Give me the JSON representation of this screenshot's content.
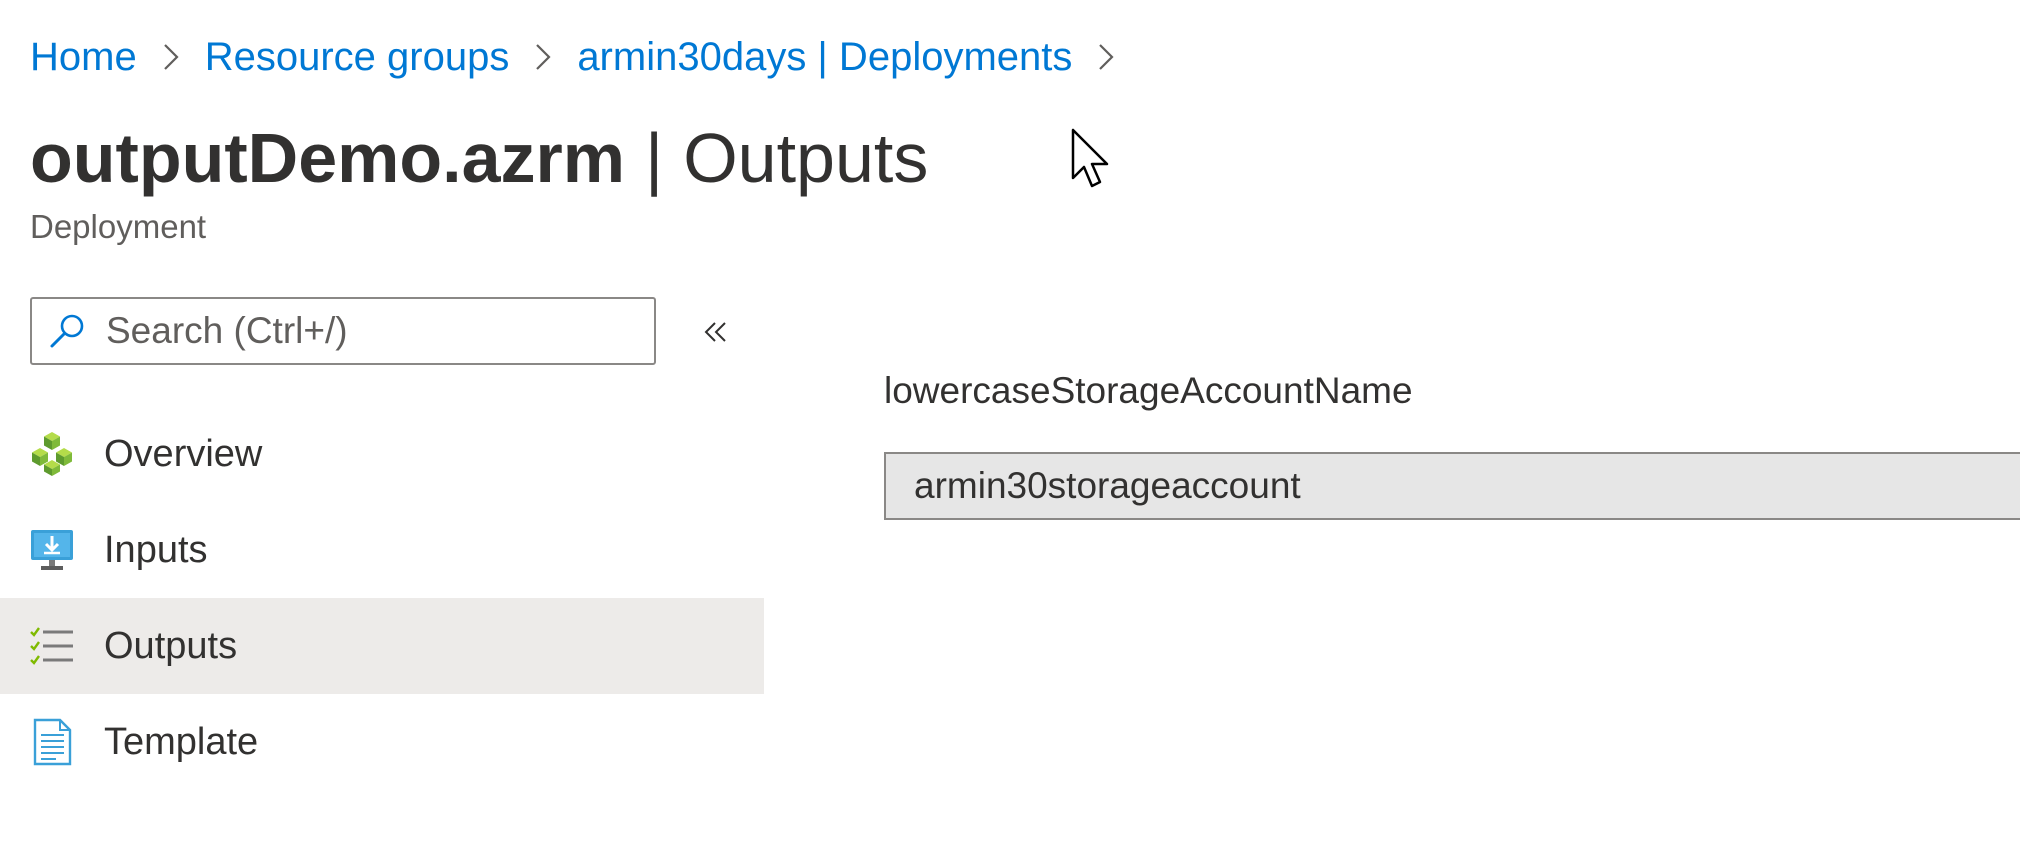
{
  "breadcrumb": {
    "items": [
      {
        "label": "Home"
      },
      {
        "label": "Resource groups"
      },
      {
        "label": "armin30days | Deployments"
      }
    ]
  },
  "header": {
    "title": "outputDemo.azrm",
    "divider": "|",
    "section": "Outputs",
    "subtitle": "Deployment"
  },
  "search": {
    "placeholder": "Search (Ctrl+/)",
    "value": ""
  },
  "sidebar": {
    "items": [
      {
        "label": "Overview",
        "icon": "cubes-icon",
        "selected": false
      },
      {
        "label": "Inputs",
        "icon": "monitor-download-icon",
        "selected": false
      },
      {
        "label": "Outputs",
        "icon": "checklist-icon",
        "selected": true
      },
      {
        "label": "Template",
        "icon": "document-icon",
        "selected": false
      }
    ]
  },
  "main": {
    "outputs": [
      {
        "name": "lowercaseStorageAccountName",
        "value": "armin30storageaccount"
      }
    ]
  },
  "colors": {
    "link": "#0078d4",
    "text": "#323130",
    "subtle_text": "#605e5c",
    "selected_bg": "#edebe9",
    "value_bg": "#e6e6e6",
    "border": "#8a8886"
  }
}
